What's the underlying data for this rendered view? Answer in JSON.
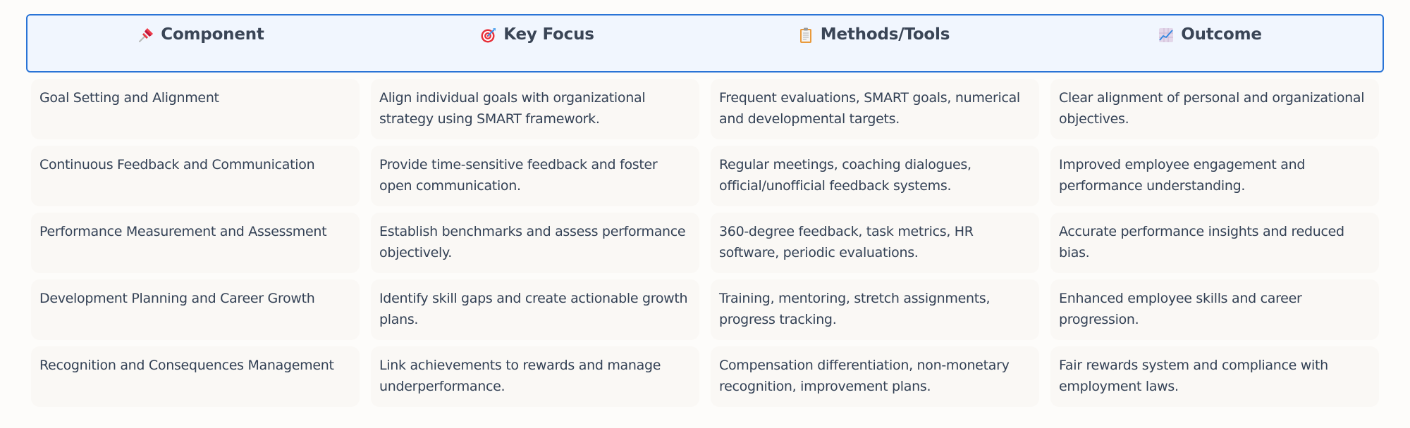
{
  "colors": {
    "header_border": "#2a74d6",
    "header_bg": "#f1f6fe",
    "cell_bg": "#faf8f5",
    "text": "#334155"
  },
  "table": {
    "columns": [
      {
        "label": "Component",
        "icon": "pushpin-icon"
      },
      {
        "label": "Key Focus",
        "icon": "target-icon"
      },
      {
        "label": "Methods/Tools",
        "icon": "clipboard-icon"
      },
      {
        "label": "Outcome",
        "icon": "chart-increasing-icon"
      }
    ],
    "rows": [
      {
        "component": "Goal Setting and Alignment",
        "key_focus": "Align individual goals with organizational strategy using SMART framework.",
        "methods_tools": "Frequent evaluations, SMART goals, numerical and developmental targets.",
        "outcome": "Clear alignment of personal and organizational objectives."
      },
      {
        "component": "Continuous Feedback and Communication",
        "key_focus": "Provide time-sensitive feedback and foster open communication.",
        "methods_tools": "Regular meetings, coaching dialogues, official/unofficial feedback systems.",
        "outcome": "Improved employee engagement and performance understanding."
      },
      {
        "component": "Performance Measurement and Assessment",
        "key_focus": "Establish benchmarks and assess performance objectively.",
        "methods_tools": "360-degree feedback, task metrics, HR software, periodic evaluations.",
        "outcome": "Accurate performance insights and reduced bias."
      },
      {
        "component": "Development Planning and Career Growth",
        "key_focus": "Identify skill gaps and create actionable growth plans.",
        "methods_tools": "Training, mentoring, stretch assignments, progress tracking.",
        "outcome": "Enhanced employee skills and career progression."
      },
      {
        "component": "Recognition and Consequences Management",
        "key_focus": "Link achievements to rewards and manage underperformance.",
        "methods_tools": "Compensation differentiation, non-monetary recognition, improvement plans.",
        "outcome": "Fair rewards system and compliance with employment laws."
      }
    ]
  }
}
